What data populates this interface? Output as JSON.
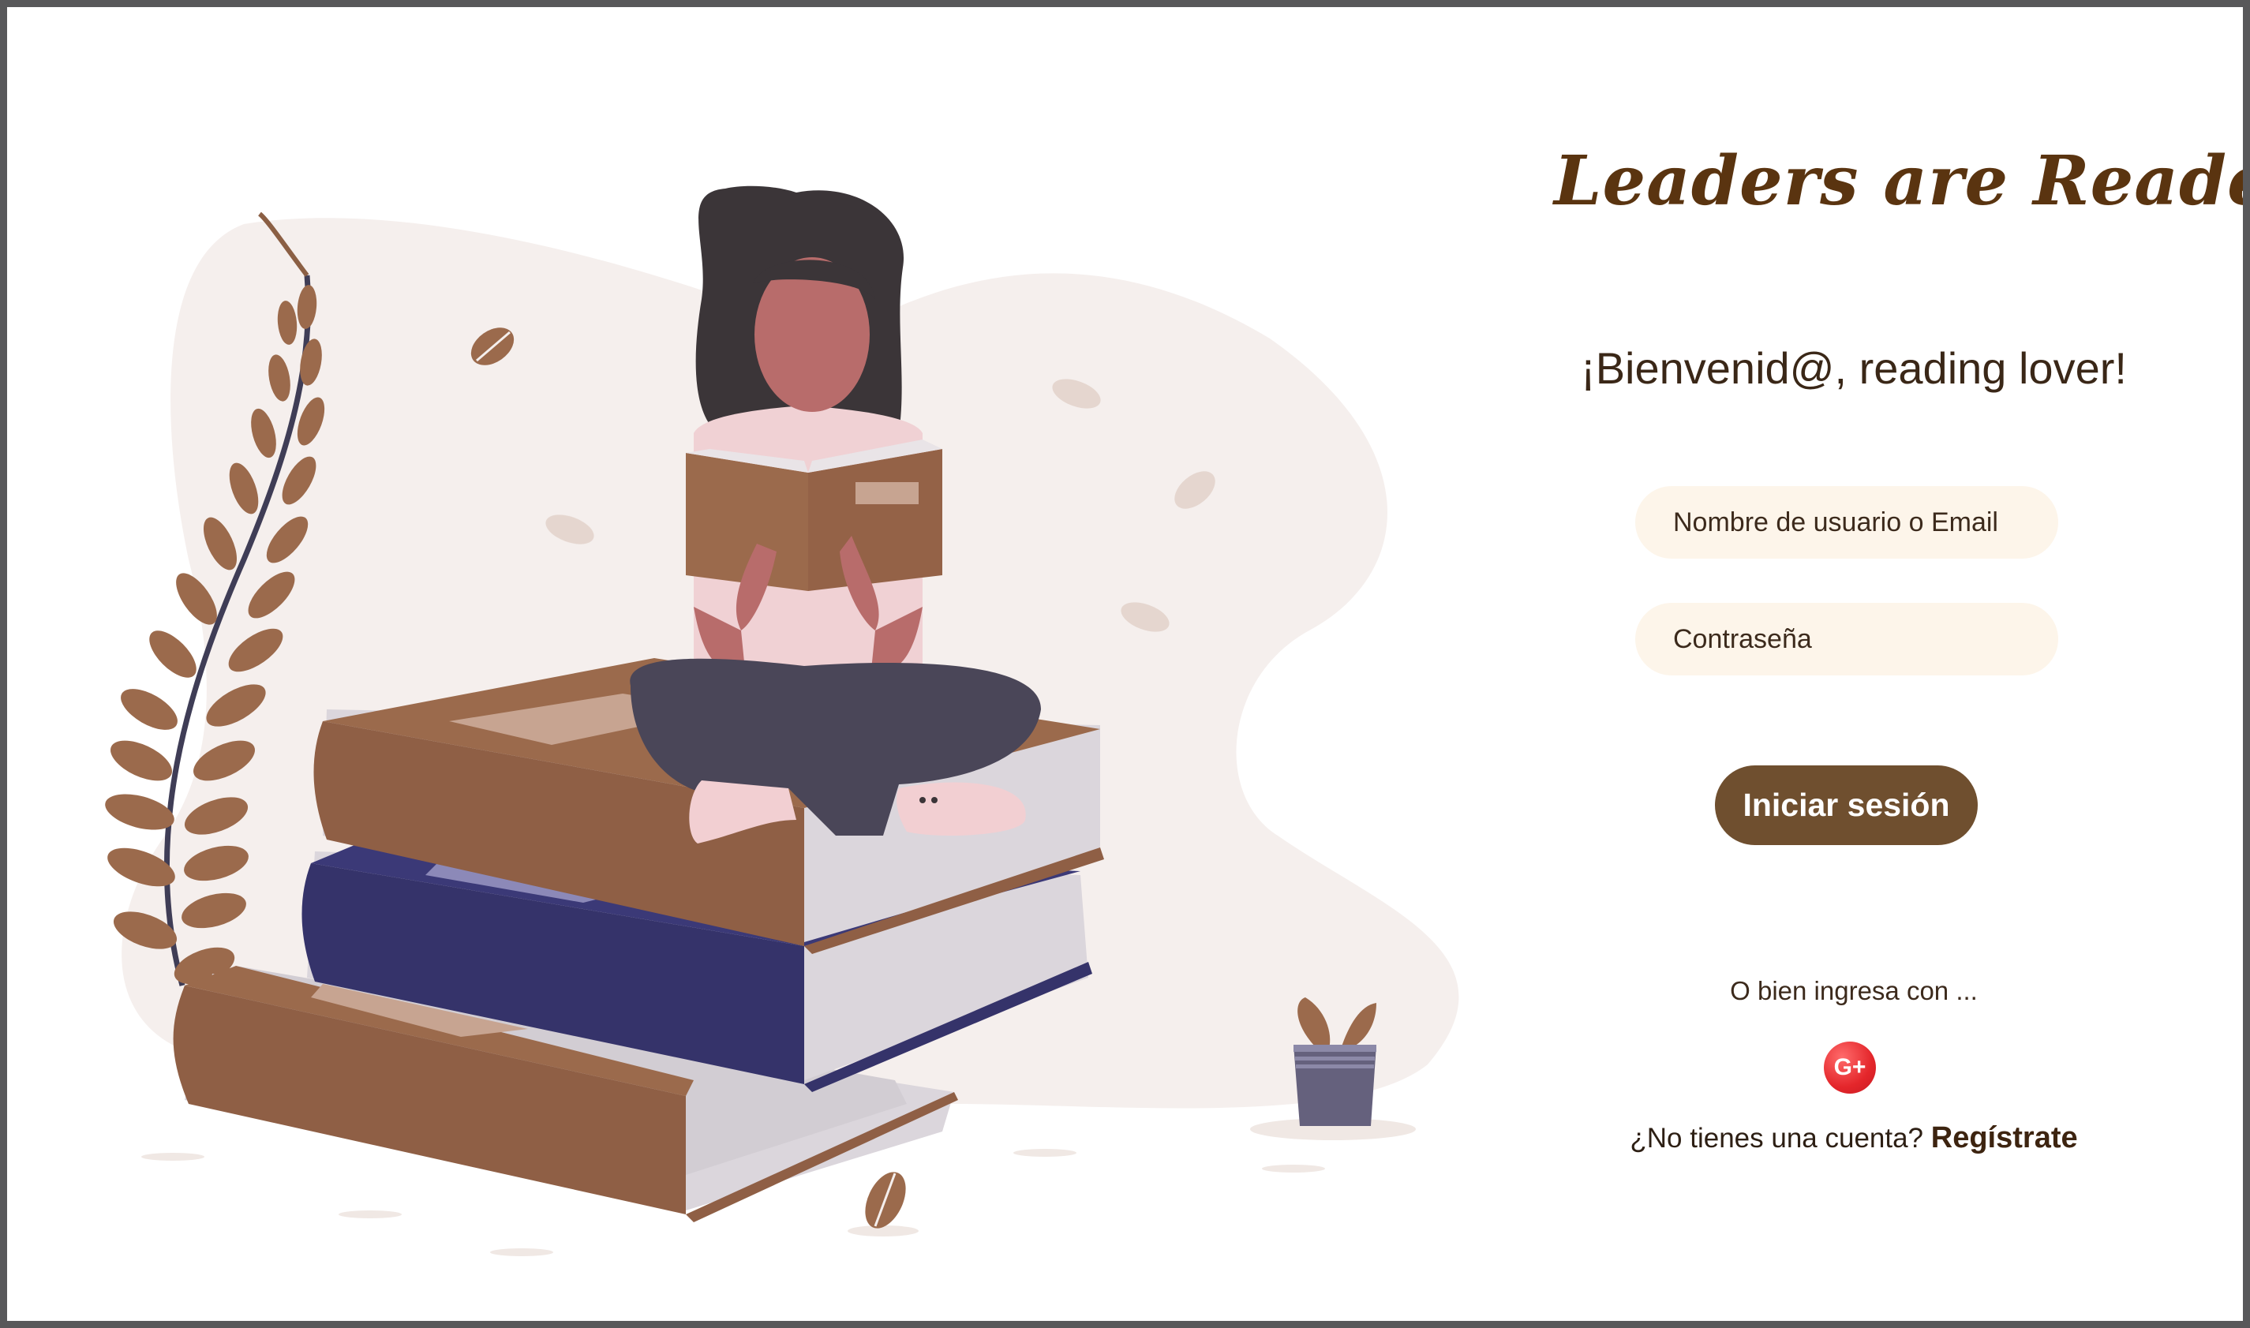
{
  "brand": {
    "title": "Leaders are Readers"
  },
  "welcome": {
    "text": "¡Bienvenid@, reading lover!"
  },
  "form": {
    "username_placeholder": "Nombre de usuario o Email",
    "password_placeholder": "Contraseña",
    "submit_label": "Iniciar sesión"
  },
  "social": {
    "prompt": "O bien ingresa con ...",
    "google_label": "G+"
  },
  "signup": {
    "question": "¿No tienes una cuenta?",
    "link_label": "Regístrate"
  },
  "colors": {
    "brand_brown": "#5a3410",
    "button_brown": "#6f4f2f",
    "input_bg": "#fdf5ea",
    "google_red": "#e4262b",
    "frame_border": "#58585a"
  },
  "icons": [
    "google-plus-icon"
  ]
}
